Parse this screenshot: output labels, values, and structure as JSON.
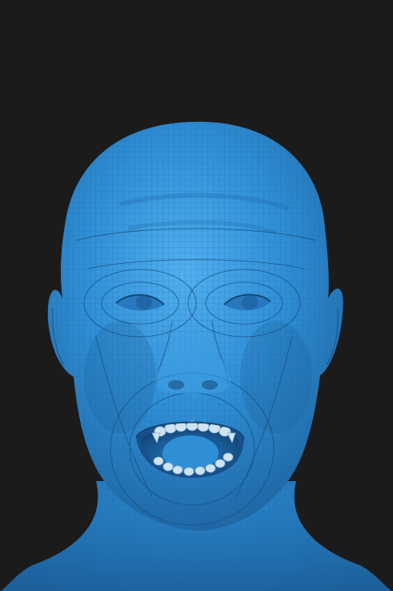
{
  "viewport": {
    "background_color": "#1b1b1c",
    "mesh_color": "#2f8fd6",
    "mesh_highlight_color": "#4aa8ea",
    "mesh_shadow_color": "#1e5f99",
    "wireframe_color": "#1d5e93",
    "mouth_interior_color": "#1e6fb3",
    "teeth_color": "#c9dff0"
  },
  "subject": {
    "icon": "head-mesh-icon",
    "expression": "mouth-open"
  }
}
